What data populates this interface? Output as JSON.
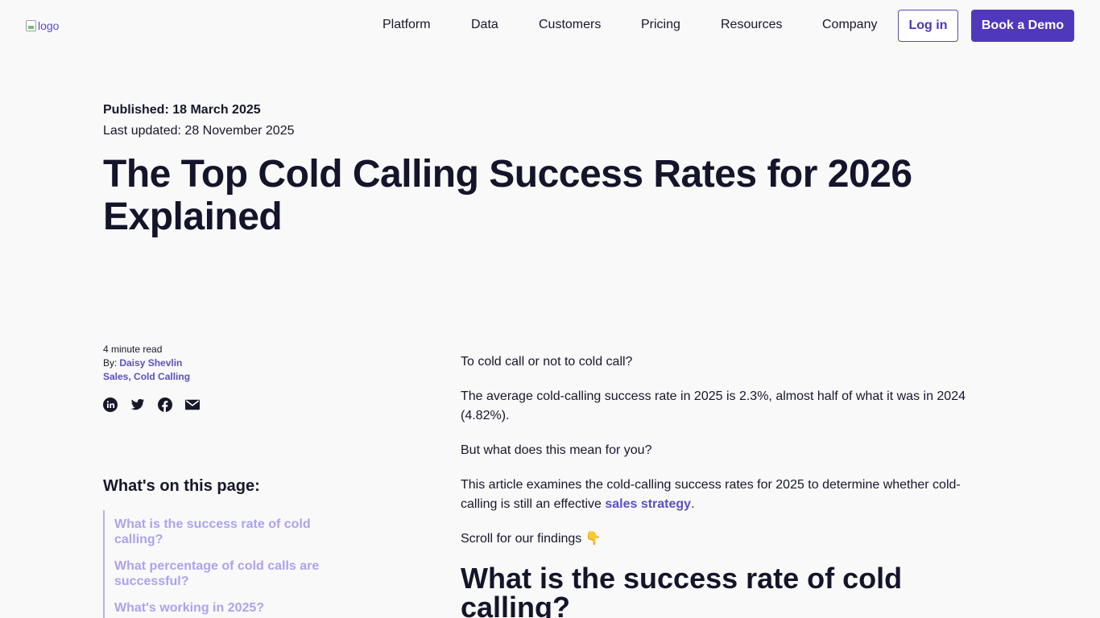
{
  "header": {
    "logo_alt": "logo",
    "nav": [
      "Platform",
      "Data",
      "Customers",
      "Pricing",
      "Resources",
      "Company"
    ],
    "login_label": "Log in",
    "demo_label": "Book a Demo"
  },
  "hero": {
    "published": "Published: 18 March 2025",
    "updated": "Last updated: 28 November 2025",
    "title": "The Top Cold Calling Success Rates for 2026 Explained"
  },
  "meta": {
    "read_time": "4 minute read",
    "by_prefix": "By:",
    "author": "Daisy Shevlin",
    "tags": "Sales, Cold Calling",
    "socials": [
      "linkedin-icon",
      "twitter-icon",
      "facebook-icon",
      "email-icon"
    ]
  },
  "toc": {
    "heading": "What's on this page:",
    "items": [
      "What is the success rate of cold calling?",
      "What percentage of cold calls are successful?",
      "What's working in 2025?"
    ]
  },
  "article": {
    "p1": "To cold call or not to cold call?",
    "p2": "The average cold-calling success rate in 2025 is 2.3%, almost half of what it was in 2024 (4.82%).",
    "p3": "But what does this mean for you?",
    "p4_before": "This article examines the cold-calling success rates for 2025 to determine whether cold-calling is still an effective ",
    "p4_link": "sales strategy",
    "p4_after": ".",
    "p5": "Scroll for our findings 👇",
    "h2": "What is the success rate of cold calling?"
  },
  "colors": {
    "accent": "#5038bd",
    "link": "#5a4fc6",
    "toc_link": "#aca3ec",
    "text": "#17172b",
    "background": "#f9f9fa"
  }
}
